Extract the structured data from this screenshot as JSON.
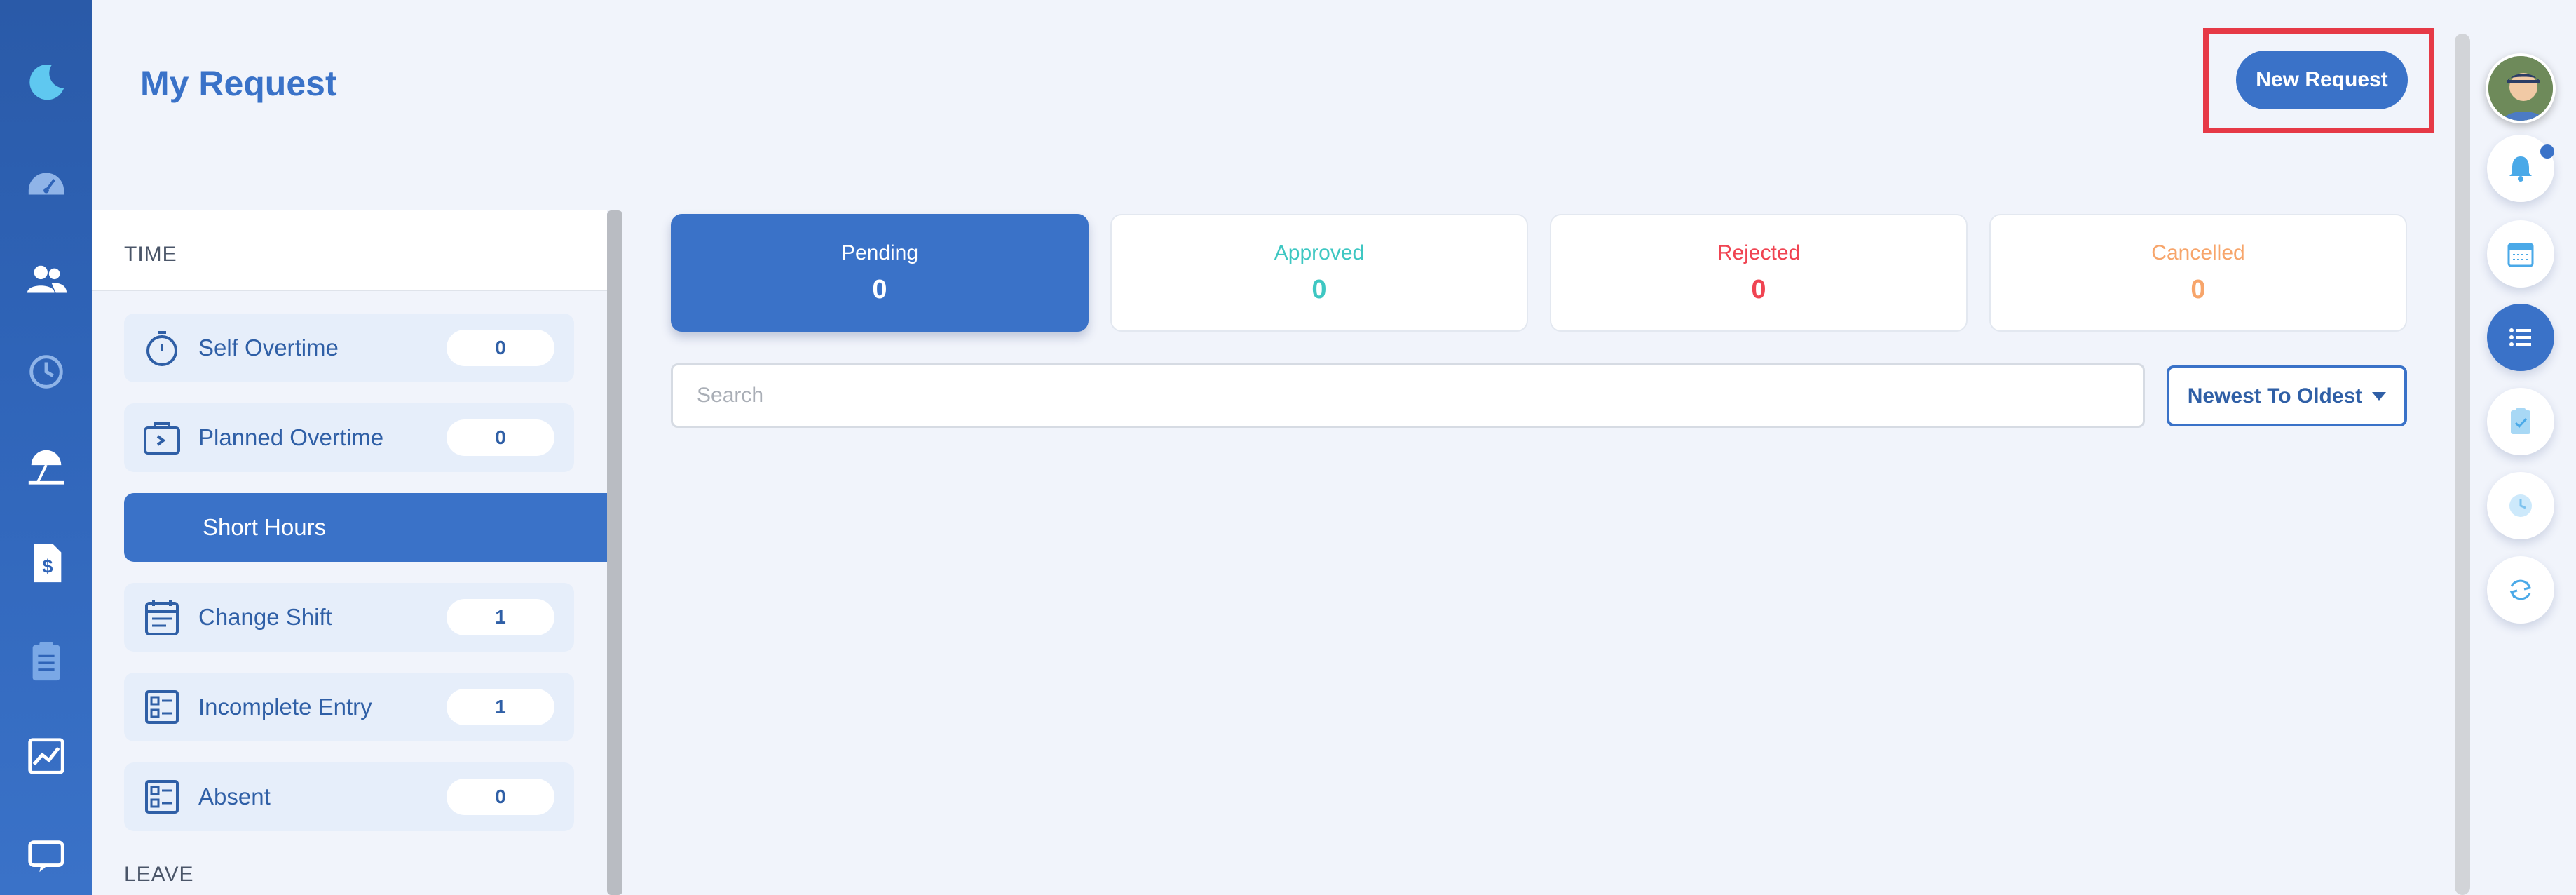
{
  "header": {
    "title": "My Request",
    "new_request_label": "New Request"
  },
  "leftnav": {
    "icons": [
      "moon-logo-icon",
      "dashboard-icon",
      "users-icon",
      "history-icon",
      "leave-icon",
      "payroll-icon",
      "clipboard-icon",
      "report-chart-icon",
      "monitor-chat-icon"
    ]
  },
  "rightrail": {
    "icons": [
      "avatar",
      "bell-icon",
      "calendar-icon",
      "list-icon",
      "clipboard-check-icon",
      "clock-icon",
      "refresh-icon"
    ],
    "active": "list-icon"
  },
  "panel": {
    "time_section": "TIME",
    "leave_section": "LEAVE",
    "items": [
      {
        "label": "Self Overtime",
        "count": "0",
        "icon": "stopwatch-icon"
      },
      {
        "label": "Planned Overtime",
        "count": "0",
        "icon": "briefcase-icon"
      },
      {
        "label": "Short Hours",
        "count": "",
        "icon": "",
        "active": true
      },
      {
        "label": "Change Shift",
        "count": "1",
        "icon": "calendar-icon"
      },
      {
        "label": "Incomplete Entry",
        "count": "1",
        "icon": "form-icon"
      },
      {
        "label": "Absent",
        "count": "0",
        "icon": "form-icon"
      }
    ]
  },
  "status_cards": [
    {
      "title": "Pending",
      "count": "0",
      "color": "#ffffff",
      "active": true
    },
    {
      "title": "Approved",
      "count": "0",
      "color": "#3ec7c2"
    },
    {
      "title": "Rejected",
      "count": "0",
      "color": "#f04452"
    },
    {
      "title": "Cancelled",
      "count": "0",
      "color": "#f7a56b"
    }
  ],
  "search": {
    "placeholder": "Search",
    "value": ""
  },
  "sort": {
    "label": "Newest To Oldest"
  }
}
